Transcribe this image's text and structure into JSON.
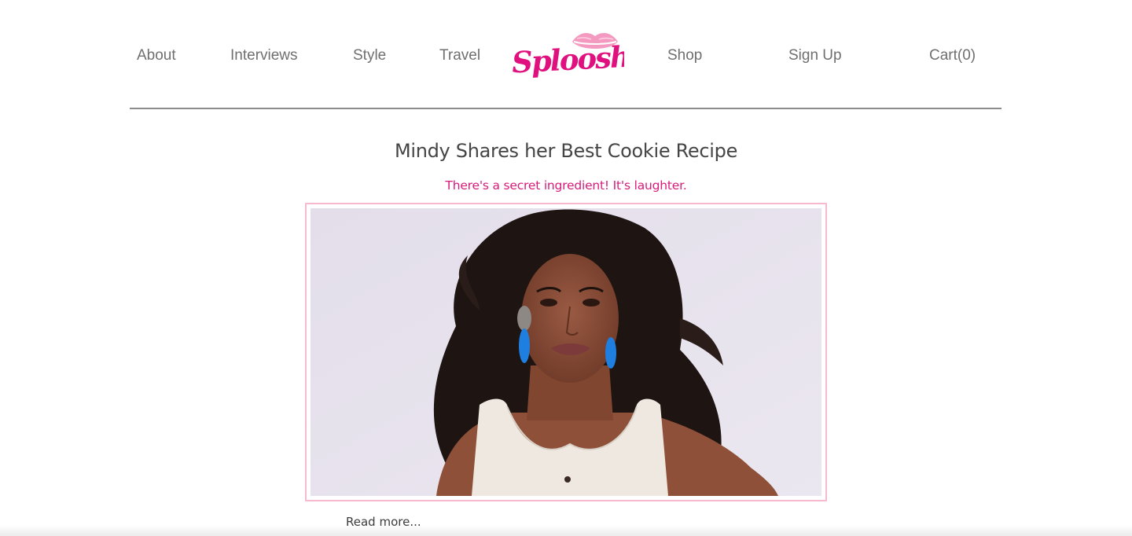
{
  "nav": {
    "about": "About",
    "interviews": "Interviews",
    "style": "Style",
    "travel": "Travel",
    "shop": "Shop",
    "sign_up": "Sign Up",
    "cart": "Cart(0)"
  },
  "brand": {
    "logo_text": "Sploosh",
    "logo_color": "#e0107e",
    "lips_color": "#f49ac1",
    "logo_icon": "lips-icon"
  },
  "article": {
    "title": "Mindy Shares her Best Cookie Recipe",
    "subtitle": "There's a secret ingredient! It's laughter.",
    "read_more": "Read more...",
    "accent_color": "#d81b7a",
    "frame_color": "#f7b9cd"
  }
}
